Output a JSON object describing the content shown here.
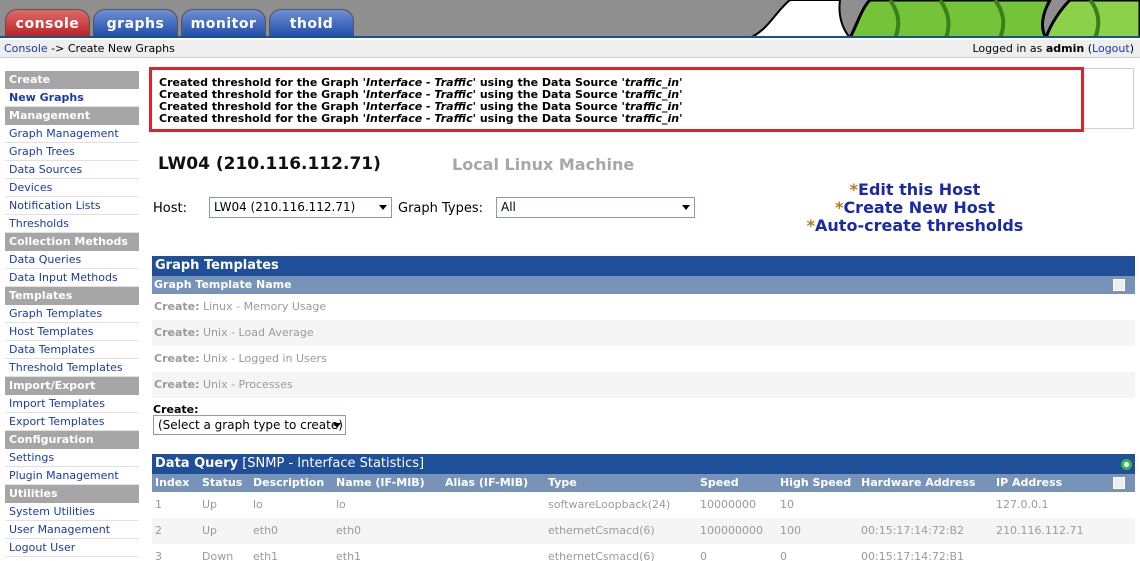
{
  "tabs": [
    {
      "label": "console"
    },
    {
      "label": "graphs"
    },
    {
      "label": "monitor"
    },
    {
      "label": "thold"
    }
  ],
  "breadcrumb": {
    "root": "Console",
    "sep": " -> ",
    "current": "Create New Graphs"
  },
  "session": {
    "prefix": "Logged in as ",
    "user": "admin",
    "logout": "Logout"
  },
  "sidebar": {
    "sections": [
      {
        "title": "Create",
        "items": [
          "New Graphs"
        ]
      },
      {
        "title": "Management",
        "items": [
          "Graph Management",
          "Graph Trees",
          "Data Sources",
          "Devices",
          "Notification Lists",
          "Thresholds"
        ]
      },
      {
        "title": "Collection Methods",
        "items": [
          "Data Queries",
          "Data Input Methods"
        ]
      },
      {
        "title": "Templates",
        "items": [
          "Graph Templates",
          "Host Templates",
          "Data Templates",
          "Threshold Templates"
        ]
      },
      {
        "title": "Import/Export",
        "items": [
          "Import Templates",
          "Export Templates"
        ]
      },
      {
        "title": "Configuration",
        "items": [
          "Settings",
          "Plugin Management"
        ]
      },
      {
        "title": "Utilities",
        "items": [
          "System Utilities",
          "User Management",
          "Logout User"
        ]
      }
    ]
  },
  "messages": {
    "prefix": "Created threshold for the Graph '",
    "graph": "Interface - Traffic",
    "mid": "' using the Data Source '",
    "source": "traffic_in",
    "suffix": "'"
  },
  "host": {
    "title": "LW04 (210.116.112.71)",
    "description": "Local Linux Machine",
    "host_label": "Host:",
    "host_value": "LW04 (210.116.112.71)",
    "graph_types_label": "Graph Types:",
    "graph_types_value": "All",
    "links": [
      "Edit this Host",
      "Create New Host",
      "Auto-create thresholds"
    ],
    "star": "*"
  },
  "graph_templates": {
    "title": "Graph Templates",
    "column": "Graph Template Name",
    "create_word": "Create:",
    "rows": [
      " Linux - Memory Usage",
      " Unix - Load Average",
      " Unix - Logged in Users",
      " Unix - Processes"
    ],
    "create_label": "Create:",
    "create_select": "(Select a graph type to create)"
  },
  "data_query": {
    "title": "Data Query",
    "subtitle": " [SNMP - Interface Statistics]",
    "columns": [
      "Index",
      "Status",
      "Description",
      "Name (IF-MIB)",
      "Alias (IF-MIB)",
      "Type",
      "Speed",
      "High Speed",
      "Hardware Address",
      "IP Address"
    ],
    "rows": [
      [
        "1",
        "Up",
        "lo",
        "lo",
        "",
        "softwareLoopback(24)",
        "10000000",
        "10",
        "",
        "127.0.0.1"
      ],
      [
        "2",
        "Up",
        "eth0",
        "eth0",
        "",
        "ethernetCsmacd(6)",
        "100000000",
        "100",
        "00:15:17:14:72:B2",
        "210.116.112.71"
      ],
      [
        "3",
        "Down",
        "eth1",
        "eth1",
        "",
        "ethernetCsmacd(6)",
        "0",
        "0",
        "00:15:17:14:72:B1",
        ""
      ]
    ]
  }
}
